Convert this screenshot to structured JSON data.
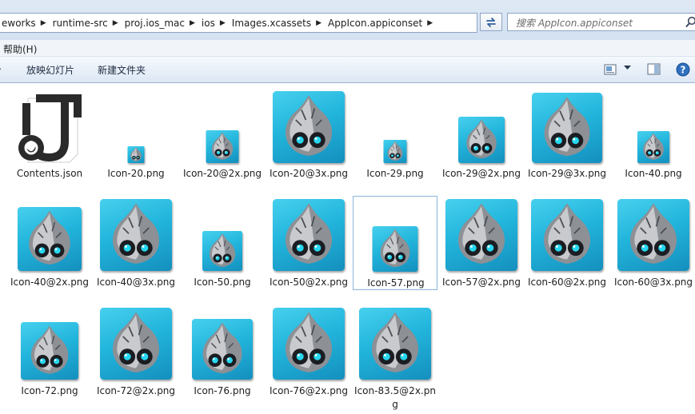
{
  "address": {
    "crumbs": [
      "eworks",
      "runtime-src",
      "proj.ios_mac",
      "ios",
      "Images.xcassets",
      "AppIcon.appiconset"
    ]
  },
  "search": {
    "placeholder": "搜索 AppIcon.appiconset"
  },
  "menu": {
    "help": "帮助(H)"
  },
  "toolbar": {
    "slideshow": "放映幻灯片",
    "new_folder": "新建文件夹"
  },
  "files": [
    {
      "name": "Contents.json",
      "icon": "json-file-icon"
    },
    {
      "name": "Icon-20.png",
      "icon": "cocos-app-icon"
    },
    {
      "name": "Icon-20@2x.png",
      "icon": "cocos-app-icon"
    },
    {
      "name": "Icon-20@3x.png",
      "icon": "cocos-app-icon"
    },
    {
      "name": "Icon-29.png",
      "icon": "cocos-app-icon"
    },
    {
      "name": "Icon-29@2x.png",
      "icon": "cocos-app-icon"
    },
    {
      "name": "Icon-29@3x.png",
      "icon": "cocos-app-icon"
    },
    {
      "name": "Icon-40.png",
      "icon": "cocos-app-icon"
    },
    {
      "name": "Icon-40@2x.png",
      "icon": "cocos-app-icon"
    },
    {
      "name": "Icon-40@3x.png",
      "icon": "cocos-app-icon"
    },
    {
      "name": "Icon-50.png",
      "icon": "cocos-app-icon"
    },
    {
      "name": "Icon-50@2x.png",
      "icon": "cocos-app-icon"
    },
    {
      "name": "Icon-57.png",
      "icon": "cocos-app-icon"
    },
    {
      "name": "Icon-57@2x.png",
      "icon": "cocos-app-icon"
    },
    {
      "name": "Icon-60@2x.png",
      "icon": "cocos-app-icon"
    },
    {
      "name": "Icon-60@3x.png",
      "icon": "cocos-app-icon"
    },
    {
      "name": "Icon-72.png",
      "icon": "cocos-app-icon"
    },
    {
      "name": "Icon-72@2x.png",
      "icon": "cocos-app-icon"
    },
    {
      "name": "Icon-76.png",
      "icon": "cocos-app-icon"
    },
    {
      "name": "Icon-76@2x.png",
      "icon": "cocos-app-icon"
    },
    {
      "name": "Icon-83.5@2x.png",
      "icon": "cocos-app-icon"
    }
  ],
  "colors": {
    "selection_border": "#8bb5dc",
    "icon_blue": "#22b5dc"
  }
}
